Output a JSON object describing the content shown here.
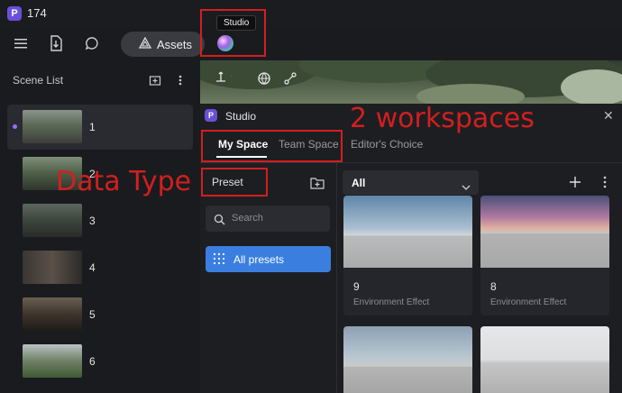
{
  "app": {
    "logo_letter": "P",
    "title": "174"
  },
  "toolbar": {
    "assets_label": "Assets"
  },
  "studio_tooltip": "Studio",
  "scene_list": {
    "title": "Scene List",
    "items": [
      {
        "label": "1",
        "active": true
      },
      {
        "label": "2"
      },
      {
        "label": "3"
      },
      {
        "label": "4"
      },
      {
        "label": "5"
      },
      {
        "label": "6"
      }
    ]
  },
  "studio": {
    "title": "Studio",
    "tabs": [
      "My Space",
      "Team Space",
      "Editor's Choice"
    ],
    "active_tab": "My Space",
    "data_type": "Preset",
    "search_placeholder": "Search",
    "all_presets_label": "All presets",
    "filter_value": "All",
    "cards": [
      {
        "number": "9",
        "type": "Environment Effect"
      },
      {
        "number": "8",
        "type": "Environment Effect"
      }
    ]
  },
  "annotations": {
    "workspaces": "2 workspaces",
    "data_type": "Data Type"
  },
  "colors": {
    "accent": "#3a7fe0",
    "annotation": "#d21f1f",
    "brand": "#6b4fd8"
  }
}
